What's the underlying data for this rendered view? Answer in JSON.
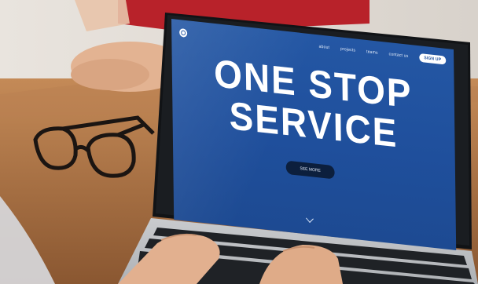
{
  "website": {
    "nav": [
      "about",
      "projects",
      "teams",
      "contact us"
    ],
    "signup_label": "SIGN UP",
    "hero_line1": "ONE STOP",
    "hero_line2": "SERVICE",
    "cta_label": "SEE MORE"
  }
}
